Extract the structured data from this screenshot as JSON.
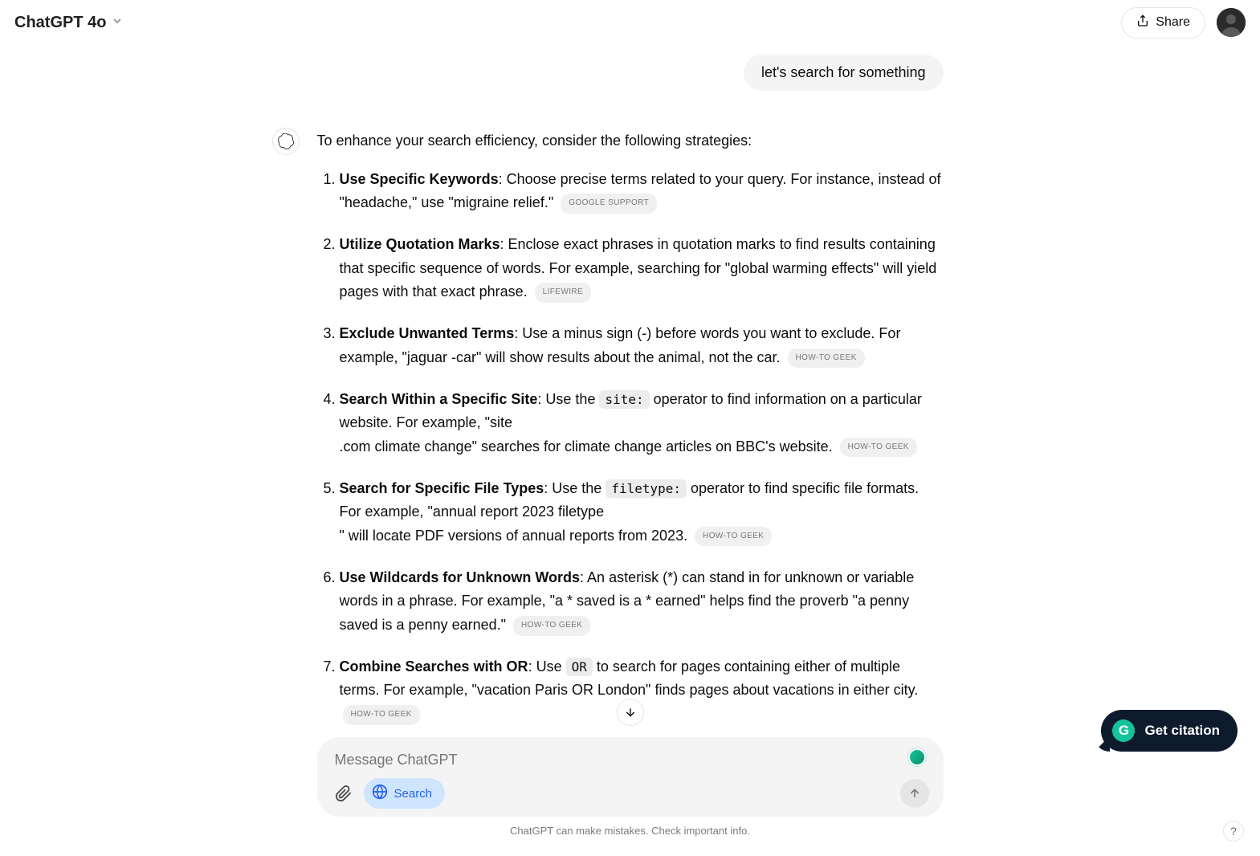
{
  "header": {
    "model": "ChatGPT 4o",
    "share": "Share"
  },
  "user_message": "let's search for something",
  "assistant": {
    "intro": "To enhance your search efficiency, consider the following strategies:",
    "items": [
      {
        "title": "Use Specific Keywords",
        "body_a": ": Choose precise terms related to your query. For instance, instead of \"headache,\" use \"migraine relief.\" ",
        "cite": "GOOGLE SUPPORT"
      },
      {
        "title": "Utilize Quotation Marks",
        "body_a": ": Enclose exact phrases in quotation marks to find results containing that specific sequence of words. For example, searching for \"global warming effects\" will yield pages with that exact phrase. ",
        "cite": "LIFEWIRE"
      },
      {
        "title": "Exclude Unwanted Terms",
        "body_a": ": Use a minus sign (-) before words you want to exclude. For example, \"jaguar -car\" will show results about the animal, not the car. ",
        "cite": "HOW-TO GEEK"
      },
      {
        "title": "Search Within a Specific Site",
        "body_a": ": Use the ",
        "code": "site:",
        "body_b": " operator to find information on a particular website. For example, \"site",
        "body_c": ".com climate change\" searches for climate change articles on BBC's website. ",
        "cite": "HOW-TO GEEK"
      },
      {
        "title": "Search for Specific File Types",
        "body_a": ": Use the ",
        "code": "filetype:",
        "body_b": " operator to find specific file formats. For example, \"annual report 2023 filetype",
        "body_c": "\" will locate PDF versions of annual reports from 2023. ",
        "cite": "HOW-TO GEEK"
      },
      {
        "title": "Use Wildcards for Unknown Words",
        "body_a": ": An asterisk (*) can stand in for unknown or variable words in a phrase. For example, \"a * saved is a * earned\" helps find the proverb \"a penny saved is a penny earned.\" ",
        "cite": "HOW-TO GEEK"
      },
      {
        "title": "Combine Searches with OR",
        "body_a": ": Use ",
        "code": "OR",
        "body_b": " to search for pages containing either of multiple terms. For example, \"vacation Paris OR London\" finds pages about vacations in either city. ",
        "cite": "HOW-TO GEEK"
      }
    ]
  },
  "composer": {
    "placeholder": "Message ChatGPT",
    "search_label": "Search"
  },
  "disclaimer": "ChatGPT can make mistakes. Check important info.",
  "citation_fab": "Get citation",
  "help": "?"
}
